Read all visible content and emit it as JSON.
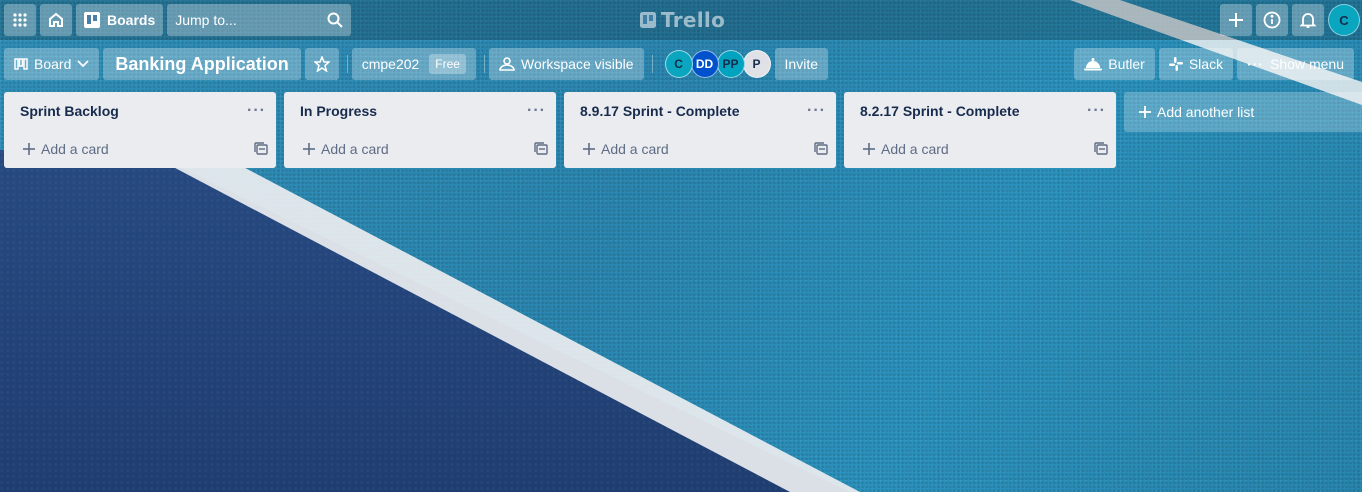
{
  "header": {
    "boards_label": "Boards",
    "search_placeholder": "Jump to...",
    "logo_text": "Trello",
    "user_initial": "C"
  },
  "board_header": {
    "view_label": "Board",
    "board_title": "Banking Application",
    "workspace_name": "cmpe202",
    "workspace_plan": "Free",
    "visibility_label": "Workspace visible",
    "members": [
      {
        "initials": "C",
        "color": "#0aa5be",
        "text_color": "#172b4d"
      },
      {
        "initials": "DD",
        "color": "#0052cc",
        "text_color": "#ffffff"
      },
      {
        "initials": "PP",
        "color": "#00a3bf",
        "text_color": "#172b4d"
      },
      {
        "initials": "P",
        "color": "#dfe1e6",
        "text_color": "#172b4d"
      }
    ],
    "invite_label": "Invite",
    "butler_label": "Butler",
    "slack_label": "Slack",
    "menu_label": "Show menu"
  },
  "lists": [
    {
      "title": "Sprint Backlog",
      "add_card_label": "Add a card"
    },
    {
      "title": "In Progress",
      "add_card_label": "Add a card"
    },
    {
      "title": "8.9.17 Sprint - Complete",
      "add_card_label": "Add a card"
    },
    {
      "title": "8.2.17 Sprint - Complete",
      "add_card_label": "Add a card"
    }
  ],
  "add_list_label": "Add another list",
  "colors": {
    "list_bg": "#ebecf0",
    "text_dark": "#172b4d",
    "accent_avatar": "#0aa5be"
  }
}
